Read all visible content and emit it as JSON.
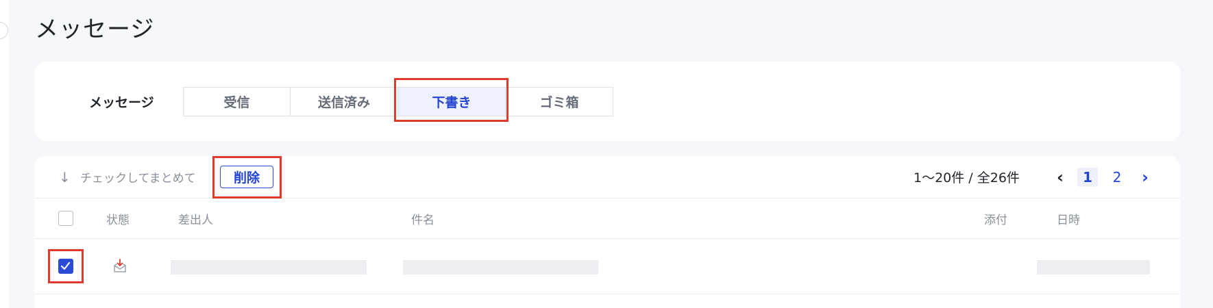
{
  "page": {
    "title": "メッセージ"
  },
  "filter": {
    "label": "メッセージ",
    "tabs": [
      {
        "label": "受信"
      },
      {
        "label": "送信済み"
      },
      {
        "label": "下書き"
      },
      {
        "label": "ゴミ箱"
      }
    ],
    "active_tab_index": 2
  },
  "toolbar": {
    "bulk_icon": "arrow-down-icon",
    "bulk_hint": "チェックしてまとめて",
    "delete_label": "削除"
  },
  "pagination": {
    "range_text": "1〜20件 / 全26件",
    "prev_icon": "chevron-left-icon",
    "next_icon": "chevron-right-icon",
    "pages": [
      "1",
      "2"
    ],
    "current_index": 0
  },
  "table": {
    "columns": [
      "状態",
      "差出人",
      "件名",
      "添付",
      "日時"
    ],
    "select_all_checked": false,
    "rows": [
      {
        "checked": true,
        "status_icon": "draft-envelope-download-icon"
      }
    ]
  },
  "colors": {
    "accent": "#2b4ad6",
    "active_tab_bg": "#eef2fe",
    "highlight": "#e0392d",
    "background": "#f6f7fb"
  }
}
